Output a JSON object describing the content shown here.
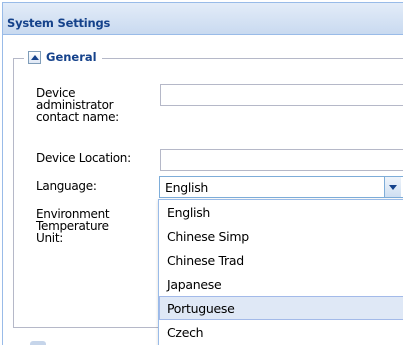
{
  "panel": {
    "title": "System Settings"
  },
  "general": {
    "legend": "General",
    "admin_contact_label": "Device\nadministrator\ncontact name:",
    "admin_contact_value": "",
    "location_label": "Device Location:",
    "location_value": "",
    "language_label": "Language:",
    "language_value": "English",
    "env_temp_label": "Environment\nTemperature\nUnit:"
  },
  "language_dropdown": {
    "options": [
      "English",
      "Chinese Simp",
      "Chinese Trad",
      "Japanese",
      "Portuguese",
      "Czech"
    ],
    "highlighted": "Portuguese"
  },
  "colors": {
    "header_text": "#15428b",
    "border": "#99bbe8",
    "highlight": "#dfe8f6"
  },
  "icons": {
    "collapse": "triangle-up-icon",
    "dropdown": "chevron-down-icon"
  }
}
